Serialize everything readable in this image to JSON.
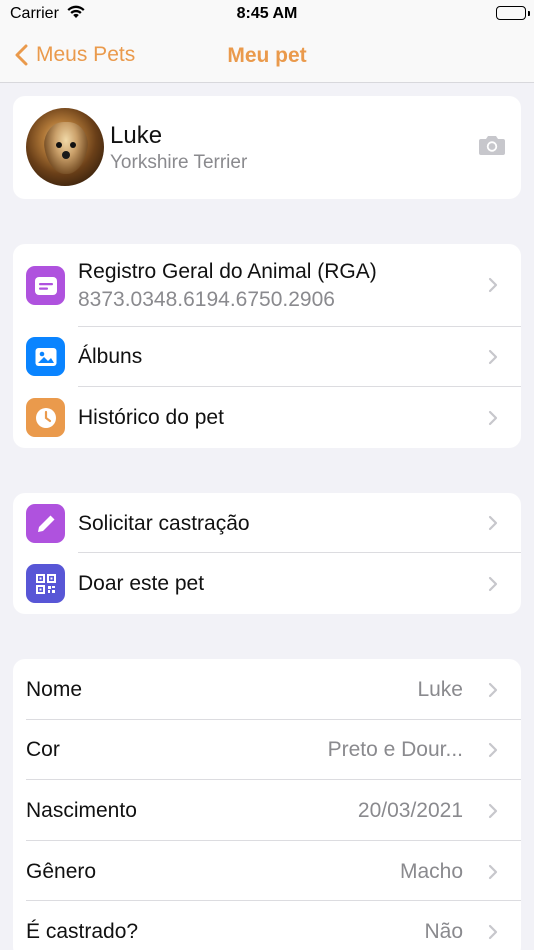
{
  "status": {
    "carrier": "Carrier",
    "time": "8:45 AM"
  },
  "nav": {
    "back_label": "Meus Pets",
    "title": "Meu pet"
  },
  "accent": "#ea9a4c",
  "pet": {
    "name": "Luke",
    "breed": "Yorkshire Terrier"
  },
  "section1": {
    "rga_label": "Registro Geral do Animal (RGA)",
    "rga_value": "8373.0348.6194.6750.2906",
    "albums": "Álbuns",
    "history": "Histórico do pet"
  },
  "section2": {
    "castration": "Solicitar castração",
    "donate": "Doar este pet"
  },
  "details": [
    {
      "label": "Nome",
      "value": "Luke"
    },
    {
      "label": "Cor",
      "value": "Preto e Dour..."
    },
    {
      "label": "Nascimento",
      "value": "20/03/2021"
    },
    {
      "label": "Gênero",
      "value": "Macho"
    },
    {
      "label": "É castrado?",
      "value": "Não"
    }
  ],
  "icons": {
    "rga": "id-card-icon",
    "albums": "photo-icon",
    "history": "clock-icon",
    "castration": "pencil-icon",
    "donate": "qr-code-icon",
    "camera": "camera-icon"
  },
  "icon_colors": {
    "rga": "#af52de",
    "albums": "#0a84ff",
    "history": "#ea9a4c",
    "castration": "#af52de",
    "donate": "#5856d6"
  }
}
